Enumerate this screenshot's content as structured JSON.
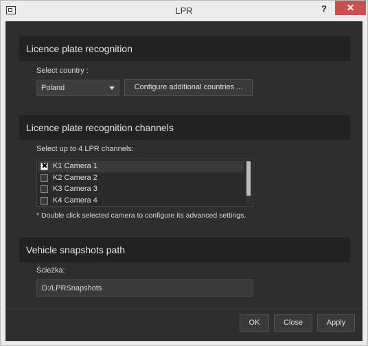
{
  "window": {
    "title": "LPR",
    "help": "?",
    "close": "✕"
  },
  "recognition": {
    "title": "Licence plate recognition",
    "country_label": "Select country :",
    "country_value": "Poland",
    "configure_button": "Configure additional countries ..."
  },
  "channels": {
    "title": "Licence plate recognition channels",
    "select_label": "Select up to 4 LPR channels:",
    "items": [
      {
        "label": "K1 Camera 1",
        "checked": true
      },
      {
        "label": "K2 Camera 2",
        "checked": false
      },
      {
        "label": "K3 Camera 3",
        "checked": false
      },
      {
        "label": "K4 Camera 4",
        "checked": false
      }
    ],
    "note": "* Double click selected camera to configure its advanced settings."
  },
  "snapshots": {
    "title": "Vehicle snapshots path",
    "path_label": "Ścieżka:",
    "path_value": "D:/LPRSnapshots"
  },
  "footer": {
    "ok": "OK",
    "close": "Close",
    "apply": "Apply"
  }
}
